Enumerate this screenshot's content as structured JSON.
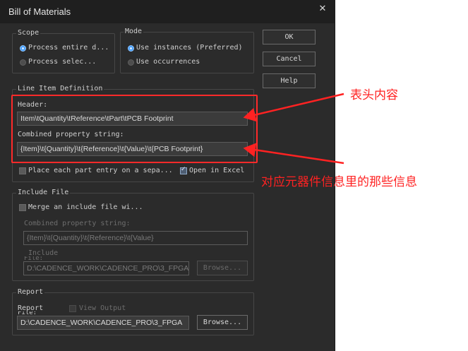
{
  "window": {
    "title": "Bill of Materials",
    "close_glyph": "✕"
  },
  "scope": {
    "legend": "Scope",
    "options": [
      {
        "label": "Process entire d...",
        "checked": true
      },
      {
        "label": "Process selec...",
        "checked": false
      }
    ]
  },
  "mode": {
    "legend": "Mode",
    "options": [
      {
        "label": "Use instances (Preferred)",
        "checked": true
      },
      {
        "label": "Use occurrences",
        "checked": false
      }
    ]
  },
  "buttons": {
    "ok": "OK",
    "cancel": "Cancel",
    "help": "Help"
  },
  "line_item": {
    "legend": "Line Item Definition",
    "header_label": "Header:",
    "header_value": "Item\\tQuantity\\tReference\\tPart\\tPCB Footprint",
    "combined_label": "Combined property string:",
    "combined_value": "{Item}\\t{Quantity}\\t{Reference}\\t{Value}\\t{PCB Footprint}",
    "place_each_label": "Place each part entry on a sepa...",
    "place_each_checked": false,
    "open_excel_label": "Open in Excel",
    "open_excel_checked": true
  },
  "include_file": {
    "legend": "Include File",
    "merge_label": "Merge an include file wi...",
    "merge_checked": false,
    "combined_label": "Combined property string:",
    "combined_value": "{Item}\\t{Quantity}\\t{Reference}\\t{Value}",
    "include_label": "Include",
    "include_label_2": "File:",
    "include_path": "D:\\CADENCE_WORK\\CADENCE_PRO\\3_FPGA",
    "browse": "Browse..."
  },
  "report": {
    "legend": "Report",
    "report_label": "Report",
    "report_label_2": "File:",
    "view_output_label": "View Output",
    "view_output_checked": false,
    "report_path": "D:\\CADENCE_WORK\\CADENCE_PRO\\3_FPGA",
    "browse": "Browse..."
  },
  "annotations": {
    "header_note": "表头内容",
    "combined_note": "对应元器件信息里的那些信息",
    "color": "#ff2222"
  }
}
